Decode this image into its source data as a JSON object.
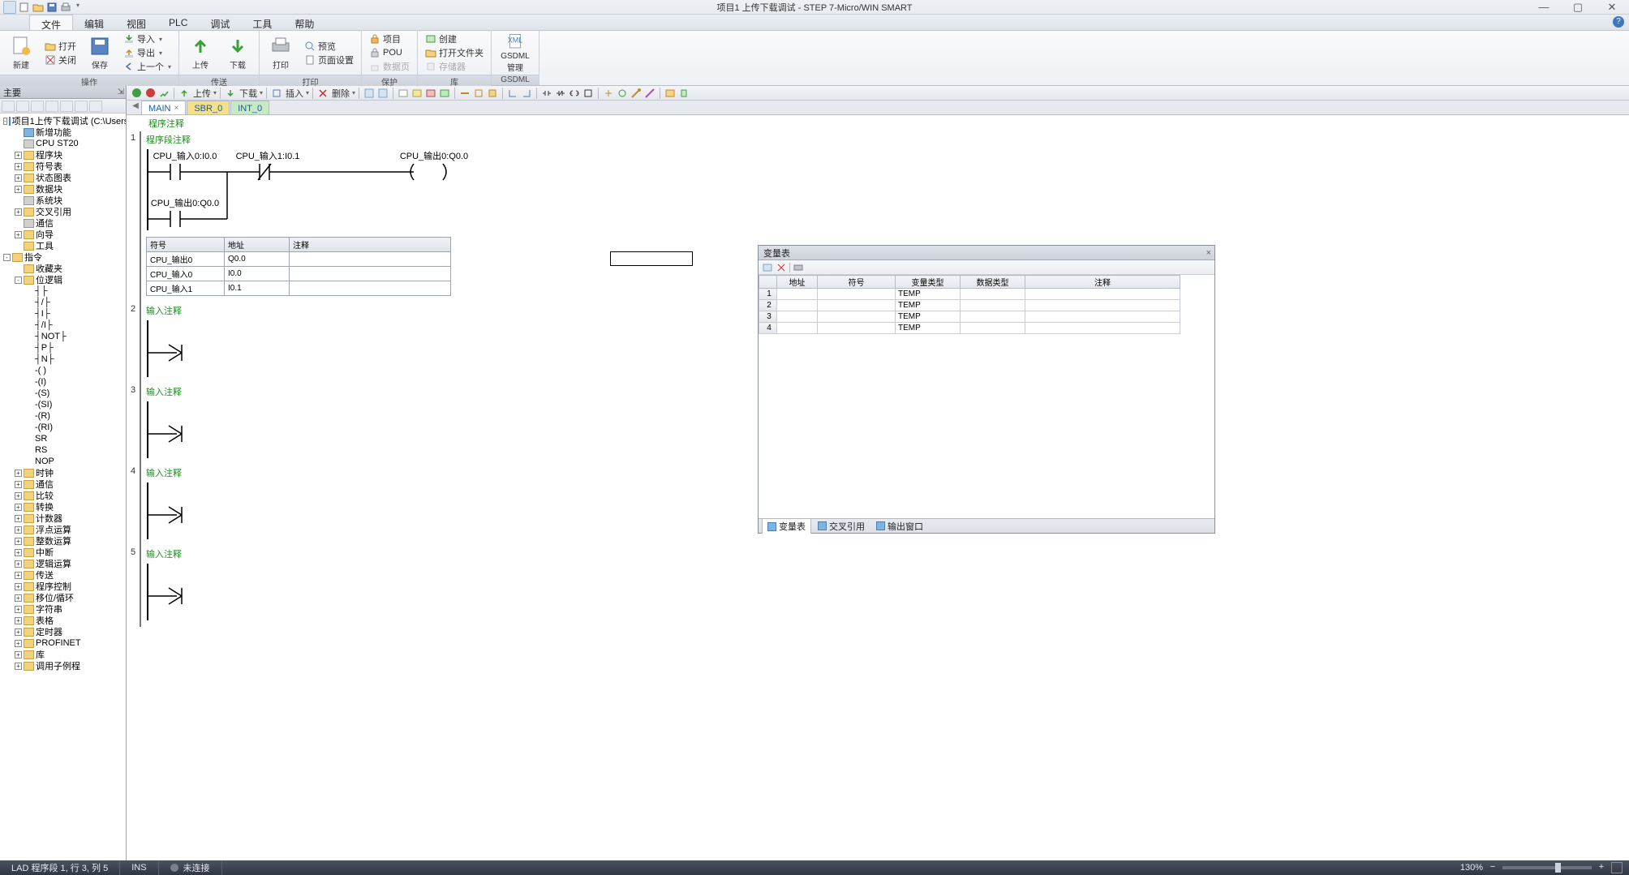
{
  "title": "项目1 上传下载调试 - STEP 7-Micro/WIN SMART",
  "menu": {
    "items": [
      "文件",
      "编辑",
      "视图",
      "PLC",
      "调试",
      "工具",
      "帮助"
    ],
    "active": 0
  },
  "ribbon": {
    "groups": [
      {
        "label": "操作",
        "big": [
          {
            "text": "新建"
          },
          {
            "text": "保存"
          }
        ],
        "small_col1": [
          "打开",
          "关闭"
        ],
        "small_col2": [
          "导入",
          "导出",
          "上一个"
        ]
      },
      {
        "label": "传送",
        "big": [
          {
            "text": "上传"
          },
          {
            "text": "下载"
          }
        ]
      },
      {
        "label": "打印",
        "big": [
          {
            "text": "打印"
          }
        ],
        "small": [
          "预览",
          "页面设置"
        ]
      },
      {
        "label": "保护",
        "small": [
          "项目",
          "POU",
          "数据页"
        ]
      },
      {
        "label": "库",
        "small": [
          "创建",
          "打开文件夹",
          "存储器"
        ]
      },
      {
        "label": "GSDML",
        "big": [
          {
            "text": "GSDML\n管理"
          }
        ]
      }
    ]
  },
  "editor_toolbar": {
    "upload": "上传",
    "download": "下载",
    "insert": "插入",
    "delete": "删除"
  },
  "tree": {
    "title": "主要",
    "root": "项目1上传下载调试 (C:\\Users\\",
    "nodes": [
      {
        "d": 2,
        "exp": "",
        "ic": "blue",
        "lbl": "新增功能"
      },
      {
        "d": 2,
        "exp": "",
        "ic": "gray",
        "lbl": "CPU ST20"
      },
      {
        "d": 2,
        "exp": "+",
        "ic": "folder",
        "lbl": "程序块"
      },
      {
        "d": 2,
        "exp": "+",
        "ic": "folder",
        "lbl": "符号表"
      },
      {
        "d": 2,
        "exp": "+",
        "ic": "folder",
        "lbl": "状态图表"
      },
      {
        "d": 2,
        "exp": "+",
        "ic": "folder",
        "lbl": "数据块"
      },
      {
        "d": 2,
        "exp": "",
        "ic": "gray",
        "lbl": "系统块"
      },
      {
        "d": 2,
        "exp": "+",
        "ic": "folder",
        "lbl": "交叉引用"
      },
      {
        "d": 2,
        "exp": "",
        "ic": "gray",
        "lbl": "通信"
      },
      {
        "d": 2,
        "exp": "+",
        "ic": "folder",
        "lbl": "向导"
      },
      {
        "d": 2,
        "exp": "",
        "ic": "folder",
        "lbl": "工具"
      },
      {
        "d": 1,
        "exp": "-",
        "ic": "folder",
        "lbl": "指令"
      },
      {
        "d": 2,
        "exp": "",
        "ic": "folder",
        "lbl": "收藏夹"
      },
      {
        "d": 2,
        "exp": "-",
        "ic": "folder",
        "lbl": "位逻辑"
      },
      {
        "d": 3,
        "exp": "",
        "ic": "",
        "lbl": "┤├"
      },
      {
        "d": 3,
        "exp": "",
        "ic": "",
        "lbl": "┤/├"
      },
      {
        "d": 3,
        "exp": "",
        "ic": "",
        "lbl": "┤I├"
      },
      {
        "d": 3,
        "exp": "",
        "ic": "",
        "lbl": "┤/I├"
      },
      {
        "d": 3,
        "exp": "",
        "ic": "",
        "lbl": "┤NOT├"
      },
      {
        "d": 3,
        "exp": "",
        "ic": "",
        "lbl": "┤P├"
      },
      {
        "d": 3,
        "exp": "",
        "ic": "",
        "lbl": "┤N├"
      },
      {
        "d": 3,
        "exp": "",
        "ic": "",
        "lbl": "-( )"
      },
      {
        "d": 3,
        "exp": "",
        "ic": "",
        "lbl": "-(I)"
      },
      {
        "d": 3,
        "exp": "",
        "ic": "",
        "lbl": "-(S)"
      },
      {
        "d": 3,
        "exp": "",
        "ic": "",
        "lbl": "-(SI)"
      },
      {
        "d": 3,
        "exp": "",
        "ic": "",
        "lbl": "-(R)"
      },
      {
        "d": 3,
        "exp": "",
        "ic": "",
        "lbl": "-(RI)"
      },
      {
        "d": 3,
        "exp": "",
        "ic": "",
        "lbl": "SR"
      },
      {
        "d": 3,
        "exp": "",
        "ic": "",
        "lbl": "RS"
      },
      {
        "d": 3,
        "exp": "",
        "ic": "",
        "lbl": "NOP"
      },
      {
        "d": 2,
        "exp": "+",
        "ic": "folder",
        "lbl": "时钟"
      },
      {
        "d": 2,
        "exp": "+",
        "ic": "folder",
        "lbl": "通信"
      },
      {
        "d": 2,
        "exp": "+",
        "ic": "folder",
        "lbl": "比较"
      },
      {
        "d": 2,
        "exp": "+",
        "ic": "folder",
        "lbl": "转换"
      },
      {
        "d": 2,
        "exp": "+",
        "ic": "folder",
        "lbl": "计数器"
      },
      {
        "d": 2,
        "exp": "+",
        "ic": "folder",
        "lbl": "浮点运算"
      },
      {
        "d": 2,
        "exp": "+",
        "ic": "folder",
        "lbl": "整数运算"
      },
      {
        "d": 2,
        "exp": "+",
        "ic": "folder",
        "lbl": "中断"
      },
      {
        "d": 2,
        "exp": "+",
        "ic": "folder",
        "lbl": "逻辑运算"
      },
      {
        "d": 2,
        "exp": "+",
        "ic": "folder",
        "lbl": "传送"
      },
      {
        "d": 2,
        "exp": "+",
        "ic": "folder",
        "lbl": "程序控制"
      },
      {
        "d": 2,
        "exp": "+",
        "ic": "folder",
        "lbl": "移位/循环"
      },
      {
        "d": 2,
        "exp": "+",
        "ic": "folder",
        "lbl": "字符串"
      },
      {
        "d": 2,
        "exp": "+",
        "ic": "folder",
        "lbl": "表格"
      },
      {
        "d": 2,
        "exp": "+",
        "ic": "folder",
        "lbl": "定时器"
      },
      {
        "d": 2,
        "exp": "+",
        "ic": "folder",
        "lbl": "PROFINET"
      },
      {
        "d": 2,
        "exp": "+",
        "ic": "folder",
        "lbl": "库"
      },
      {
        "d": 2,
        "exp": "+",
        "ic": "folder",
        "lbl": "调用子例程"
      }
    ]
  },
  "tabs": [
    {
      "label": "MAIN",
      "cls": "active",
      "closable": true
    },
    {
      "label": "SBR_0",
      "cls": "sbr"
    },
    {
      "label": "INT_0",
      "cls": "int"
    }
  ],
  "program_comment": "程序注释",
  "networks": [
    {
      "n": "1",
      "comment": "程序段注释",
      "contacts": [
        {
          "label": "CPU_输入0:I0.0"
        },
        {
          "label": "CPU_输入1:I0.1",
          "type": "nc"
        },
        {
          "label_out": "CPU_输出0:Q0.0"
        }
      ],
      "branch_label": "CPU_输出0:Q0.0",
      "sym": {
        "headers": [
          "符号",
          "地址",
          "注释"
        ],
        "rows": [
          [
            "CPU_输出0",
            "Q0.0",
            ""
          ],
          [
            "CPU_输入0",
            "I0.0",
            ""
          ],
          [
            "CPU_输入1",
            "I0.1",
            ""
          ]
        ]
      }
    },
    {
      "n": "2",
      "comment": "输入注释"
    },
    {
      "n": "3",
      "comment": "输入注释"
    },
    {
      "n": "4",
      "comment": "输入注释"
    },
    {
      "n": "5",
      "comment": "输入注释"
    }
  ],
  "var_panel": {
    "title": "变量表",
    "headers": [
      "",
      "地址",
      "符号",
      "变量类型",
      "数据类型",
      "注释"
    ],
    "rows": [
      {
        "n": "1",
        "type": "TEMP"
      },
      {
        "n": "2",
        "type": "TEMP"
      },
      {
        "n": "3",
        "type": "TEMP"
      },
      {
        "n": "4",
        "type": "TEMP"
      }
    ],
    "tabs": [
      "变量表",
      "交叉引用",
      "输出窗口"
    ]
  },
  "status": {
    "pos": "LAD 程序段 1, 行 3, 列 5",
    "ins": "INS",
    "conn": "未连接",
    "zoom": "130%"
  }
}
